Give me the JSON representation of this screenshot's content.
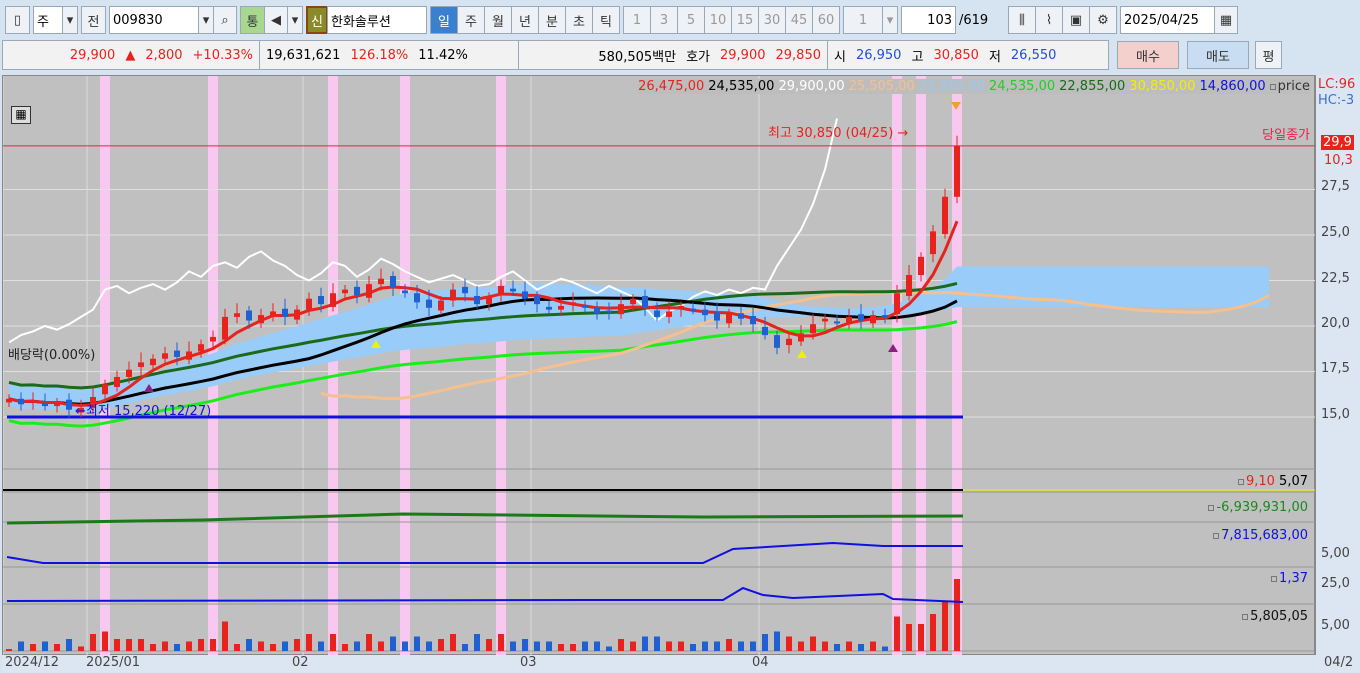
{
  "toolbar": {
    "market": "주",
    "prev": "전",
    "code": "009830",
    "tong": "통",
    "sin": "신",
    "name": "한화솔루션",
    "periods": [
      "일",
      "주",
      "월",
      "년",
      "분",
      "초",
      "틱"
    ],
    "minutes": [
      "1",
      "3",
      "5",
      "10",
      "15",
      "30",
      "45",
      "60"
    ],
    "unit": "1",
    "count": "103",
    "total": "/619",
    "date": "2025/04/25"
  },
  "quote": {
    "price": "29,900",
    "arrow": "▲",
    "change": "2,800",
    "rate": "+10.33%",
    "volume": "19,631,621",
    "vol_ratio": "126.18%",
    "turnover": "11.42%",
    "amount": "580,505백만",
    "hoga_label": "호가",
    "ask": "29,900",
    "bid": "29,850",
    "open_label": "시",
    "open": "26,950",
    "high_label": "고",
    "high": "30,850",
    "low_label": "저",
    "low": "26,550",
    "buy": "매수",
    "sell": "매도",
    "avg": "평"
  },
  "legend": {
    "v1": "26,475,00",
    "v2": "24,535,00",
    "v3": "29,900,00",
    "v4": "25,505,00",
    "v5": "22,855,00",
    "v6": "24,535,00",
    "v7": "22,855,00",
    "v8": "30,850,00",
    "v9": "14,860,00",
    "price": "price"
  },
  "annotations": {
    "high": "최고 30,850 (04/25) →",
    "low": "←최저 15,220 (12/27)",
    "close_line": "당일종가",
    "dividend": "배당락(0.00%)"
  },
  "axis": {
    "lc": "LC:96",
    "hc": "HC:-3",
    "cur": "29,9",
    "rate": "10,3",
    "ticks": [
      "27,5",
      "25,0",
      "22,5",
      "20,0",
      "17,5",
      "15,0"
    ],
    "sub_ticks": [
      "5,00",
      "25,0",
      "5,00"
    ]
  },
  "panels": {
    "p1a": "9,10",
    "p1b": "5,07",
    "p2": "-6,939,931,00",
    "p3": "7,815,683,00",
    "p4": "1,37",
    "p5": "5,805,05"
  },
  "xaxis": {
    "labels": [
      "2024/12",
      "2025/01",
      "02",
      "03",
      "04"
    ],
    "right": "04/2"
  },
  "chart_data": {
    "type": "candlestick",
    "closes": [
      16000,
      15700,
      15900,
      15600,
      15800,
      15400,
      15500,
      16100,
      16800,
      17200,
      17600,
      18000,
      18200,
      18500,
      18300,
      18600,
      19000,
      19400,
      20500,
      20700,
      20300,
      20600,
      20800,
      20500,
      20900,
      21500,
      21200,
      21800,
      22000,
      21700,
      22300,
      22600,
      22100,
      21800,
      21300,
      21000,
      21400,
      22000,
      21800,
      21200,
      21600,
      22200,
      21900,
      21500,
      21200,
      20900,
      21100,
      21300,
      21000,
      20700,
      20800,
      21200,
      21500,
      21000,
      20500,
      20800,
      21100,
      20900,
      20600,
      20300,
      20700,
      20400,
      20100,
      19500,
      18800,
      19300,
      19600,
      20100,
      20400,
      20200,
      20500,
      20300,
      20600,
      20500,
      21800,
      22800,
      23800,
      25200,
      27100,
      29900
    ],
    "ylim": [
      12500,
      31500
    ],
    "month_start_bars": [
      0,
      7,
      25,
      44,
      63
    ]
  }
}
